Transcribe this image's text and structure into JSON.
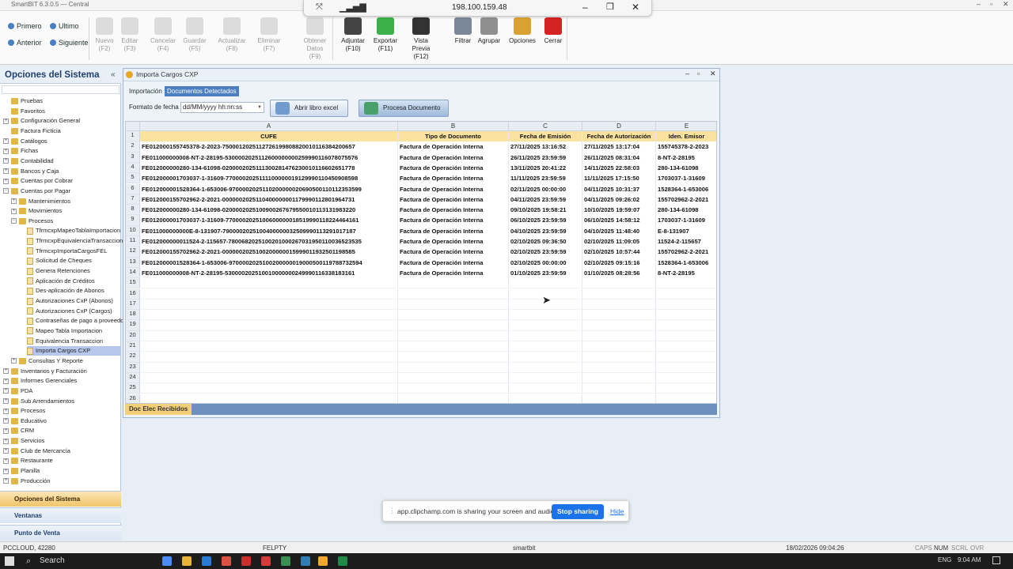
{
  "window": {
    "title": "SmartBIT 6.3.0.5 — Central"
  },
  "remote": {
    "ip": "198.100.159.48"
  },
  "nav": {
    "first": "Primero",
    "last": "Ultimo",
    "prev": "Anterior",
    "next": "Siguiente"
  },
  "toolbar": [
    {
      "label": "Nuevo",
      "key": "(F2)",
      "enabled": false
    },
    {
      "label": "Editar",
      "key": "(F3)",
      "enabled": false
    },
    {
      "label": "Cancelar",
      "key": "(F4)",
      "enabled": false
    },
    {
      "label": "Guardar",
      "key": "(F5)",
      "enabled": false
    },
    {
      "label": "Actualizar",
      "key": "(F8)",
      "enabled": false
    },
    {
      "label": "Eliminar",
      "key": "(F7)",
      "enabled": false
    },
    {
      "label": "Obtener Datos",
      "key": "(F9)",
      "enabled": false
    },
    {
      "label": "Adjuntar",
      "key": "(F10)",
      "enabled": true
    },
    {
      "label": "Exportar",
      "key": "(F11)",
      "enabled": true
    },
    {
      "label": "Vista Previa",
      "key": "(F12)",
      "enabled": true
    },
    {
      "label": "Filtrar",
      "key": "",
      "enabled": true
    },
    {
      "label": "Agrupar",
      "key": "",
      "enabled": true
    },
    {
      "label": "Opciones",
      "key": "",
      "enabled": true
    },
    {
      "label": "Cerrar",
      "key": "",
      "enabled": true
    }
  ],
  "sidebar": {
    "title": "Opciones del Sistema",
    "items": [
      {
        "label": "Pruebas",
        "level": 0
      },
      {
        "label": "Favoritos",
        "level": 0
      },
      {
        "label": "Configuración General",
        "level": 0
      },
      {
        "label": "Factura Ficticia",
        "level": 0
      },
      {
        "label": "Catálogos",
        "level": 0
      },
      {
        "label": "Fichas",
        "level": 0
      },
      {
        "label": "Contabilidad",
        "level": 0
      },
      {
        "label": "Bancos y Caja",
        "level": 0
      },
      {
        "label": "Cuentas por Cobrar",
        "level": 0
      },
      {
        "label": "Cuentas por Pagar",
        "level": 0
      },
      {
        "label": "Mantenimientos",
        "level": 1
      },
      {
        "label": "Movimientos",
        "level": 1
      },
      {
        "label": "Procesos",
        "level": 1
      },
      {
        "label": "TfrmcxpMapeoTablaImportacion",
        "level": 2
      },
      {
        "label": "TfrmcxpEquivalenciaTransaccion",
        "level": 2
      },
      {
        "label": "TfrmcxpImportaCargosFEL",
        "level": 2
      },
      {
        "label": "Solicitud de Cheques",
        "level": 2
      },
      {
        "label": "Genera Retenciones",
        "level": 2
      },
      {
        "label": "Aplicación de Créditos",
        "level": 2
      },
      {
        "label": "Des-aplicación de Abonos",
        "level": 2
      },
      {
        "label": "Autorizaciones CxP (Abonos)",
        "level": 2
      },
      {
        "label": "Autorizaciones CxP (Cargos)",
        "level": 2
      },
      {
        "label": "Contraseñas de pago a proveedor",
        "level": 2
      },
      {
        "label": "Mapeo Tabla Importacion",
        "level": 2
      },
      {
        "label": "Equivalencia Transaccion",
        "level": 2
      },
      {
        "label": "Importa Cargos CXP",
        "level": 2
      },
      {
        "label": "Consultas Y Reporte",
        "level": 1
      },
      {
        "label": "Inventarios y Facturación",
        "level": 0
      },
      {
        "label": "Informes Gerenciales",
        "level": 0
      },
      {
        "label": "PDA",
        "level": 0
      },
      {
        "label": "Sub Arrendamientos",
        "level": 0
      },
      {
        "label": "Procesos",
        "level": 0
      },
      {
        "label": "Educativo",
        "level": 0
      },
      {
        "label": "CRM",
        "level": 0
      },
      {
        "label": "Servicios",
        "level": 0
      },
      {
        "label": "Club de Mercancía",
        "level": 0
      },
      {
        "label": "Restaurante",
        "level": 0
      },
      {
        "label": "Planilla",
        "level": 0
      },
      {
        "label": "Producción",
        "level": 0
      }
    ],
    "selected": "Importa Cargos CXP",
    "tabs": [
      "Opciones del Sistema",
      "Ventanas",
      "Punto de Venta"
    ]
  },
  "form": {
    "title": "Importa Cargos CXP",
    "tabs": [
      "Importación",
      "Documentos Detectados"
    ],
    "active_tab": "Documentos Detectados",
    "date_format_label": "Formato de fecha",
    "date_format_value": "dd/MM/yyyy hh:nn:ss",
    "open_excel": "Abrir libro excel",
    "process": "Procesa Documento",
    "sheet_tab": "Doc Elec Recibidos"
  },
  "grid": {
    "col_letters": [
      "A",
      "B",
      "C",
      "D",
      "E"
    ],
    "headers": [
      "CUFE",
      "Tipo de Documento",
      "Fecha de Emisión",
      "Fecha de Autorización",
      "Iden. Emisor"
    ],
    "rows": [
      [
        "FE012000155745378-2-2023-750001202511272619980882001011638420065​7",
        "Factura de Operación Interna",
        "27/11/2025 13:16:52",
        "27/11/2025 13:17:04",
        "155745378-2-2023"
      ],
      [
        "FE011000000008-NT-2-28195-530000202511260000000025999011607807557​6",
        "Factura de Operación Interna",
        "26/11/2025 23:59:59",
        "26/11/2025 08:31:04",
        "8-NT-2-28195"
      ],
      [
        "FE012000000280-134-61098-020000202511130028147623001011660265177​8",
        "Factura de Operación Interna",
        "13/11/2025 20:41:22",
        "14/11/2025 22:58:03",
        "280-134-61098"
      ],
      [
        "FE012000001703037-1-31609-770000202511110000001912999011045090859​8",
        "Factura de Operación Interna",
        "11/11/2025 23:59:59",
        "11/11/2025 17:15:50",
        "1703037-1-31609"
      ],
      [
        "FE012000001528364-1-653006-970000202511020000002069050011011235359​9",
        "Factura de Operación Interna",
        "02/11/2025 00:00:00",
        "04/11/2025 10:31:37",
        "1528364-1-653006"
      ],
      [
        "FE012000155702962-2-2021-000000202511040000000117999011280196473​1",
        "Factura de Operación Interna",
        "04/11/2025 23:59:59",
        "04/11/2025 09:26:02",
        "155702962-2-2021"
      ],
      [
        "FE012000000280-134-61098-020000202510090026767955001011313198322​0",
        "Factura de Operación Interna",
        "09/10/2025 19:58:21",
        "10/10/2025 19:59:07",
        "280-134-61098"
      ],
      [
        "FE012000001703037-1-31609-770000202510060000001851999011822446416​1",
        "Factura de Operación Interna",
        "06/10/2025 23:59:59",
        "06/10/2025 14:58:12",
        "1703037-1-31609"
      ],
      [
        "FE011000000000E-8-131907-790000202510040000003250999011329101718​7",
        "Factura de Operación Interna",
        "04/10/2025 23:59:59",
        "04/10/2025 11:48:40",
        "E-8-131907"
      ],
      [
        "FE012000000011524-2-115657-780068202510020100026703195011003652353​5",
        "Factura de Operación Interna",
        "02/10/2025 09:36:50",
        "02/10/2025 11:09:05",
        "11524-2-115657"
      ],
      [
        "FE012000155702962-2-2021-000000202510020000001599901193250119858​5",
        "Factura de Operación Interna",
        "02/10/2025 23:59:59",
        "02/10/2025 10:57:44",
        "155702962-2-2021"
      ],
      [
        "FE012000001528364-1-653006-970000202510020000001900050011978873259​4",
        "Factura de Operación Interna",
        "02/10/2025 00:00:00",
        "02/10/2025 09:15:16",
        "1528364-1-653006"
      ],
      [
        "FE011000000008-NT-2-28195-530000202510010000000249990116338183161",
        "Factura de Operación Interna",
        "01/10/2025 23:59:59",
        "01/10/2025 08:28:56",
        "8-NT-2-28195"
      ]
    ],
    "empty_row_numbers": [
      15,
      16,
      17,
      18,
      19,
      20,
      21,
      22,
      23,
      24,
      25,
      26
    ]
  },
  "share": {
    "text": "app.clipchamp.com is sharing your screen and audio.",
    "stop": "Stop sharing",
    "hide": "Hide"
  },
  "status": {
    "server": "PCCLOUD, 42280",
    "company": "FELPTY",
    "user": "smartbit",
    "datetime": "18/02/2026 09:04:26",
    "caps": "CAPS",
    "num": "NUM",
    "scrl": "SCRL",
    "ovr": "OVR"
  },
  "taskbar": {
    "search": "Search",
    "lang": "ENG",
    "clock": "9:04 AM"
  }
}
